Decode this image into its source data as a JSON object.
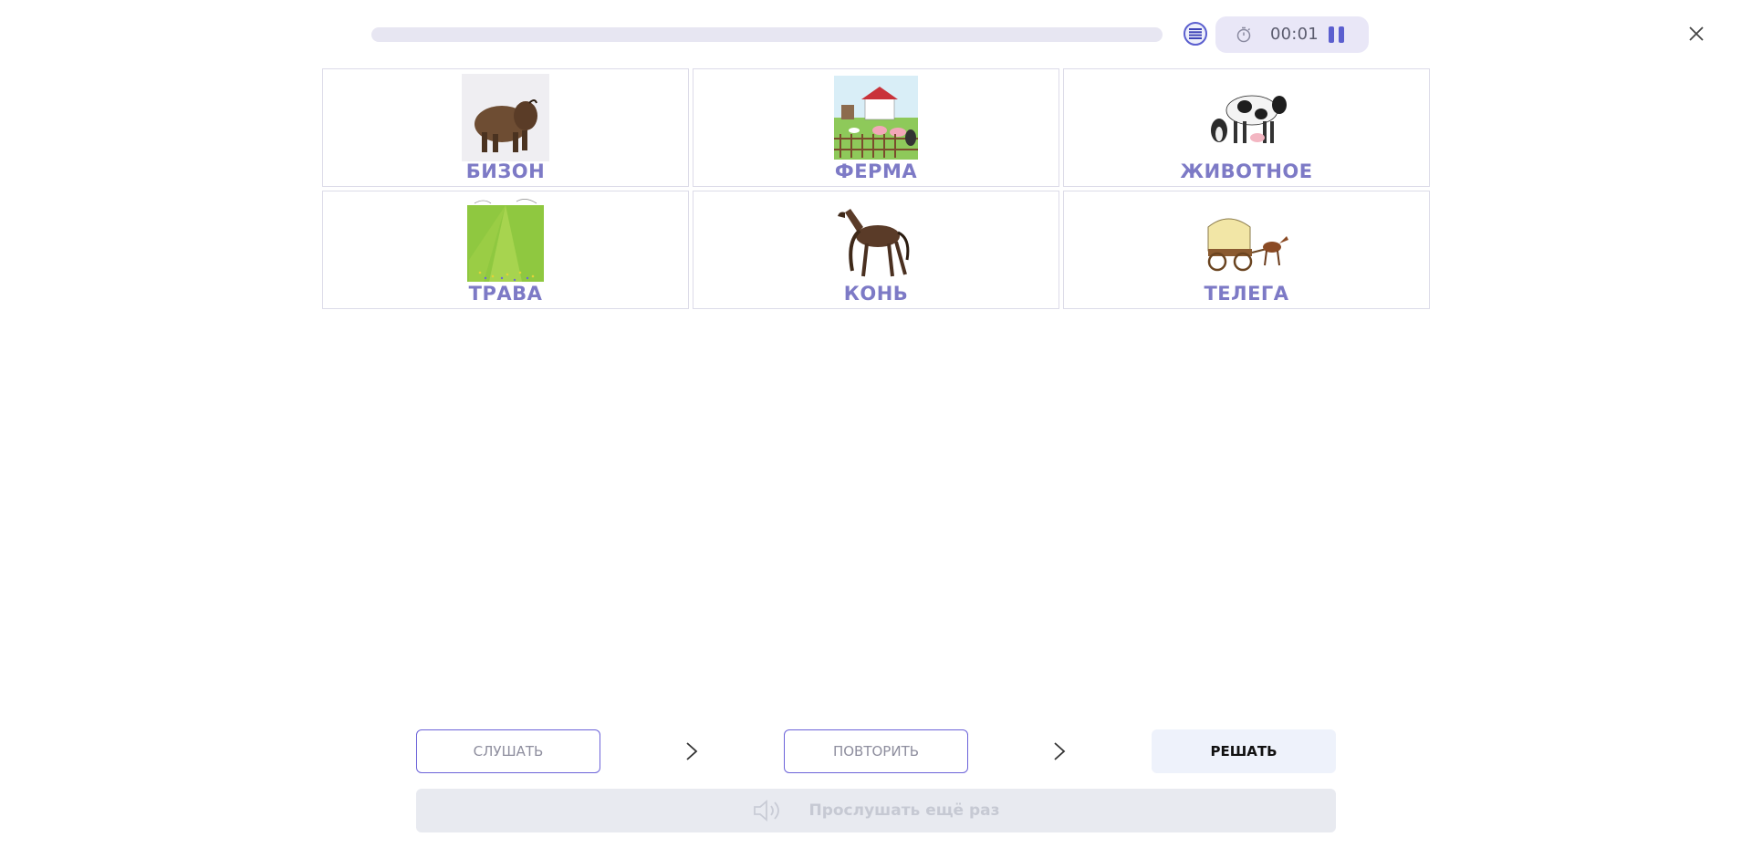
{
  "top_bar": {
    "timer": "00:01",
    "icons": {
      "list": "list-icon",
      "timer": "stopwatch-icon",
      "pause": "pause-icon",
      "close": "close-icon"
    }
  },
  "cards": [
    {
      "word": "БИЗОН",
      "image": "bison-image"
    },
    {
      "word": "ФЕРМА",
      "image": "farm-image"
    },
    {
      "word": "ЖИВОТНОЕ",
      "image": "animals-image"
    },
    {
      "word": "ТРАВА",
      "image": "grass-image"
    },
    {
      "word": "КОНЬ",
      "image": "horse-image"
    },
    {
      "word": "ТЕЛЕГА",
      "image": "cart-image"
    }
  ],
  "controls": {
    "listen": "СЛУШАТЬ",
    "repeat": "ПОВТОРИТЬ",
    "solve": "РЕШАТЬ",
    "replay": "Прослушать ещё раз"
  },
  "colors": {
    "accent": "#5b5fcf",
    "word": "#7d7ac6",
    "progress_track": "#e7e6f2"
  }
}
